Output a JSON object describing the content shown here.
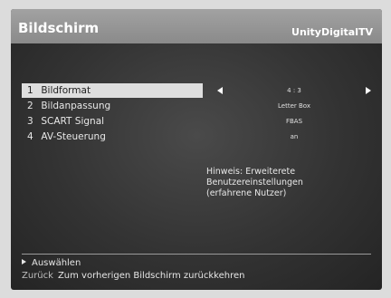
{
  "header": {
    "title": "Bildschirm",
    "brand": "UnityDigitalTV"
  },
  "menu": {
    "items": [
      {
        "number": "1",
        "label": "Bildformat",
        "value": "4 : 3",
        "selected": true
      },
      {
        "number": "2",
        "label": "Bildanpassung",
        "value": "Letter Box",
        "selected": false
      },
      {
        "number": "3",
        "label": "SCART Signal",
        "value": "FBAS",
        "selected": false
      },
      {
        "number": "4",
        "label": "AV-Steuerung",
        "value": "an",
        "selected": false
      }
    ]
  },
  "hint": {
    "text": "Hinweis: Erweiterete\nBenutzereinstellungen\n(erfahrene Nutzer)"
  },
  "footer": {
    "select_label": "Auswählen",
    "back_key": "Zurück",
    "back_text": "Zum vorherigen Bildschirm zurückkehren"
  },
  "icons": {
    "select": "play-icon",
    "value_prev": "arrow-left-icon",
    "value_next": "arrow-right-icon"
  },
  "colors": {
    "header_bg": "#959595",
    "screen_bg": "#333333",
    "selected_bg": "#dedede",
    "text": "#e8e8e8"
  }
}
